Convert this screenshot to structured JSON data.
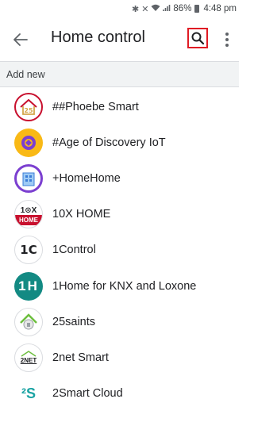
{
  "status_bar": {
    "battery": "86%",
    "time": "4:48 pm",
    "icons": [
      "bluetooth-icon",
      "mute-icon",
      "wifi-icon",
      "signal-icon",
      "battery-icon"
    ]
  },
  "app_bar": {
    "back_icon": "arrow-back-icon",
    "title": "Home control",
    "search_icon": "search-icon",
    "more_icon": "more-vert-icon"
  },
  "section": {
    "label": "Add new"
  },
  "items": [
    {
      "label": "##Phoebe Smart",
      "logo": "phoebe-logo"
    },
    {
      "label": "#Age of Discovery IoT",
      "logo": "age-of-discovery-logo"
    },
    {
      "label": "+HomeHome",
      "logo": "homehome-logo"
    },
    {
      "label": "10X HOME",
      "logo": "10x-home-logo",
      "logo_text": "HOME"
    },
    {
      "label": "1Control",
      "logo": "1control-logo",
      "logo_text": "1C"
    },
    {
      "label": "1Home for KNX and Loxone",
      "logo": "1home-logo",
      "logo_text": "1H"
    },
    {
      "label": "25saints",
      "logo": "25saints-logo"
    },
    {
      "label": "2net Smart",
      "logo": "2net-logo",
      "logo_text": "2NET"
    },
    {
      "label": "2Smart Cloud",
      "logo": "2smart-logo",
      "logo_text": "²S"
    }
  ],
  "colors": {
    "accent_red": "#e01b24",
    "header_bg": "#f1f3f4",
    "age_of_discovery_yellow": "#f9b916",
    "homehome_purple": "#7b3fd0",
    "tenx_red": "#c8102e",
    "onehome_teal": "#138a83",
    "twosmart_teal": "#1aa3a3",
    "saints_green": "#6dbf3e"
  }
}
